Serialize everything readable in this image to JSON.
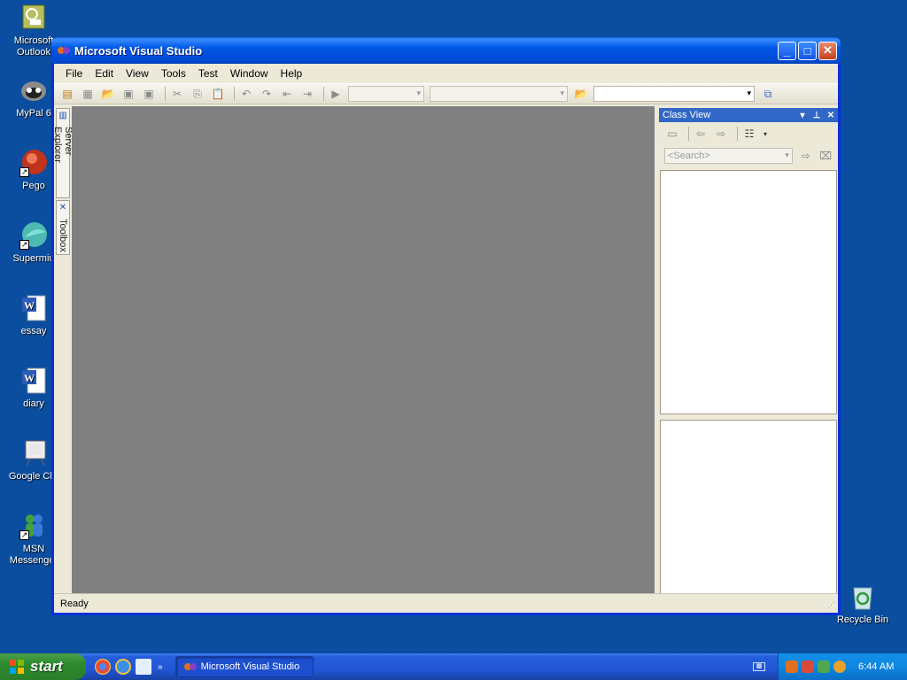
{
  "desktop": {
    "icons": [
      {
        "label": "Microsoft\nOutlook",
        "icon": "outlook-icon"
      },
      {
        "label": "MyPal 6",
        "icon": "mypal-icon"
      },
      {
        "label": "Pego",
        "icon": "pego-icon"
      },
      {
        "label": "Supermiu",
        "icon": "supermium-icon"
      },
      {
        "label": "essay",
        "icon": "word-document-icon"
      },
      {
        "label": "diary",
        "icon": "word-document-icon"
      },
      {
        "label": "Google Chr",
        "icon": "google-chrome-icon"
      },
      {
        "label": "MSN\nMessenger",
        "icon": "msn-messenger-icon"
      }
    ],
    "recycle_bin": {
      "label": "Recycle Bin",
      "icon": "recycle-bin-icon"
    }
  },
  "window": {
    "title": "Microsoft Visual Studio",
    "controls": {
      "minimize": "_",
      "maximize": "□",
      "close": "✕"
    },
    "menu": [
      "File",
      "Edit",
      "View",
      "Tools",
      "Test",
      "Window",
      "Help"
    ],
    "side_tabs": {
      "server_explorer": "Server Explorer",
      "toolbox": "Toolbox"
    },
    "class_view": {
      "title": "Class View",
      "search_placeholder": "<Search>"
    },
    "status": "Ready"
  },
  "taskbar": {
    "start_label": "start",
    "task_button": "Microsoft Visual Studio",
    "quick_launch_more": "»",
    "clock": "6:44 AM"
  },
  "colors": {
    "desktop": "#0b4d9e",
    "editor_bg": "#808080",
    "titlebar": "#0058e6",
    "class_view_title": "#3167c6"
  }
}
